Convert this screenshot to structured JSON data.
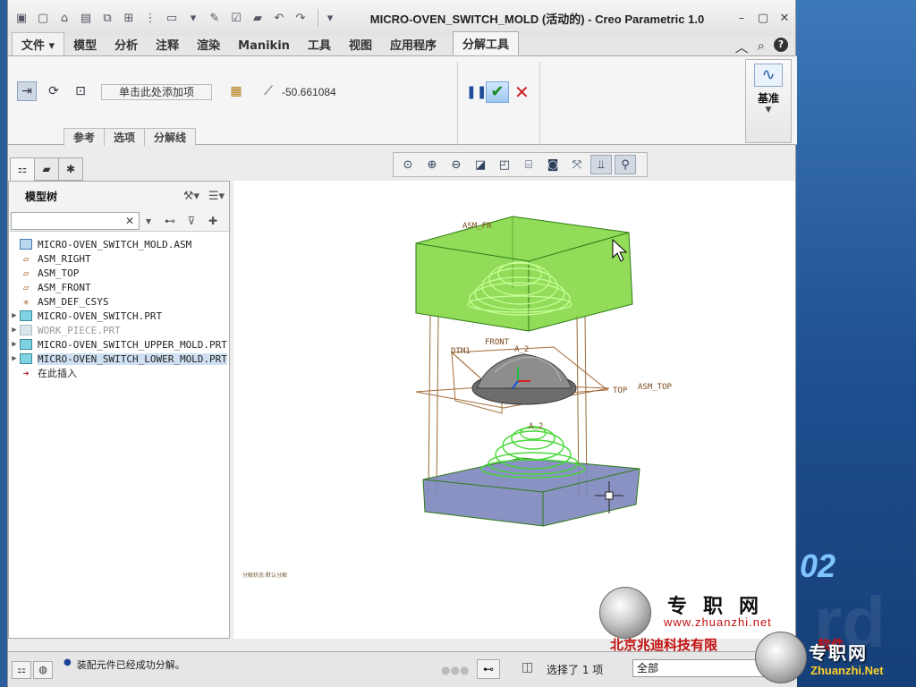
{
  "window": {
    "title": "MICRO-OVEN_SWITCH_MOLD (活动的) - Creo Parametric 1.0",
    "controls": [
      "–",
      "▢",
      "✕"
    ]
  },
  "quick_access": [
    "new-icon",
    "open-icon",
    "save-icon",
    "regenerate-icon",
    "windows-icon",
    "close-icon",
    "undo-icon",
    "redo-icon",
    "customize-icon"
  ],
  "menu": {
    "tabs": [
      "文件",
      "模型",
      "分析",
      "注释",
      "渲染",
      "Manikin",
      "工具",
      "视图",
      "应用程序"
    ],
    "active_tab": "分解工具"
  },
  "ribbon": {
    "add_item_label": "单击此处添加项",
    "distance_value": "-50.661084",
    "sub_tabs": [
      "参考",
      "选项",
      "分解线"
    ],
    "datum_label": "基准"
  },
  "navigator": {
    "title": "模型树",
    "search_placeholder": "",
    "tree": [
      {
        "label": "MICRO-OVEN_SWITCH_MOLD.ASM",
        "icon": "asm",
        "expander": "",
        "style": ""
      },
      {
        "label": "ASM_RIGHT",
        "icon": "plane",
        "expander": "",
        "style": ""
      },
      {
        "label": "ASM_TOP",
        "icon": "plane",
        "expander": "",
        "style": ""
      },
      {
        "label": "ASM_FRONT",
        "icon": "plane",
        "expander": "",
        "style": ""
      },
      {
        "label": "ASM_DEF_CSYS",
        "icon": "csys",
        "expander": "",
        "style": ""
      },
      {
        "label": "MICRO-OVEN_SWITCH.PRT",
        "icon": "part",
        "expander": "▶",
        "style": ""
      },
      {
        "label": "WORK_PIECE.PRT",
        "icon": "part-dim",
        "expander": "▶",
        "style": "dim"
      },
      {
        "label": "MICRO-OVEN_SWITCH_UPPER_MOLD.PRT",
        "icon": "part",
        "expander": "▶",
        "style": ""
      },
      {
        "label": "MICRO-OVEN_SWITCH_LOWER_MOLD.PRT",
        "icon": "part",
        "expander": "▶",
        "style": "hl"
      },
      {
        "label": "在此插入",
        "icon": "insert",
        "expander": "",
        "style": "insert"
      }
    ]
  },
  "graphics": {
    "labels": {
      "asm_front": "ASM_FR",
      "front": "FRONT",
      "dtm": "DTM1",
      "top": "TOP",
      "asm_top": "ASM_TOP",
      "a2_upper": "A_2",
      "a2_lower": "A_2"
    },
    "stamp": "分解状态:默认分解"
  },
  "status": {
    "message": "装配元件已经成功分解。",
    "selected": "选择了 1 项",
    "filter": "全部"
  },
  "watermark": {
    "brand": "专职网",
    "url": "www.zhuanzhi.net",
    "company": "北京兆迪科技有限",
    "company_tail": "软件",
    "brand2": "专职网",
    "url2": "Zhuanzhi.Net",
    "corner_digits": "02"
  }
}
